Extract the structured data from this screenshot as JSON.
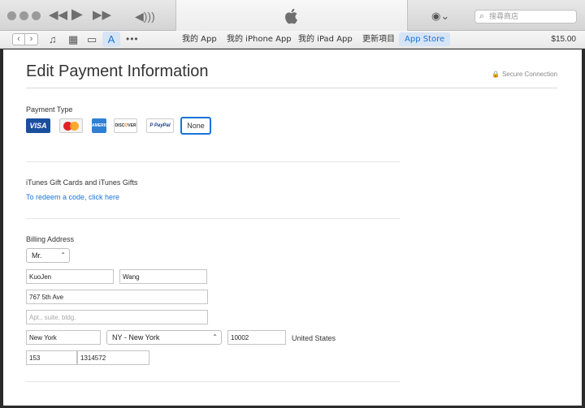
{
  "titlebar": {
    "prev_icon": "rewind-icon",
    "play_icon": "play-icon",
    "next_icon": "fast-forward-icon",
    "volume_icon": "volume-icon",
    "center_icon": "apple-logo-icon",
    "account_icon": "account-icon",
    "search_placeholder": "搜尋商店"
  },
  "navbar": {
    "back_icon": "chevron-left-icon",
    "forward_icon": "chevron-right-icon",
    "media": [
      "music-icon",
      "film-icon",
      "tv-icon",
      "app-store-icon",
      "more-icon"
    ],
    "tabs": [
      {
        "label": "我的 App"
      },
      {
        "label": "我的 iPhone App"
      },
      {
        "label": "我的 iPad App"
      },
      {
        "label": "更新項目"
      },
      {
        "label": "App Store",
        "selected": true
      }
    ],
    "balance": "$15.00"
  },
  "page": {
    "title": "Edit Payment Information",
    "secure_label": "Secure Connection",
    "payment": {
      "label": "Payment Type",
      "cards": {
        "visa": "VISA",
        "amex": "AMERICAN EXPRESS",
        "discover_a": "DISC",
        "discover_o": "O",
        "discover_b": "VER",
        "paypal": "P PayPal",
        "none": "None"
      },
      "selected": "None"
    },
    "gift": {
      "label": "iTunes Gift Cards and iTunes Gifts",
      "link": "To redeem a code, click here"
    },
    "billing": {
      "label": "Billing Address",
      "title_value": "Mr.",
      "first_name": "KuoJen",
      "last_name": "Wang",
      "street": "767 5th Ave",
      "apt_placeholder": "Apt., suite, bldg.",
      "city": "New York",
      "state": "NY - New York",
      "zip": "10002",
      "country": "United States",
      "area_code": "153",
      "phone": "1314572"
    }
  },
  "colors": {
    "accent": "#1a73d9",
    "selected_tab_bg": "#d6e4f5"
  }
}
